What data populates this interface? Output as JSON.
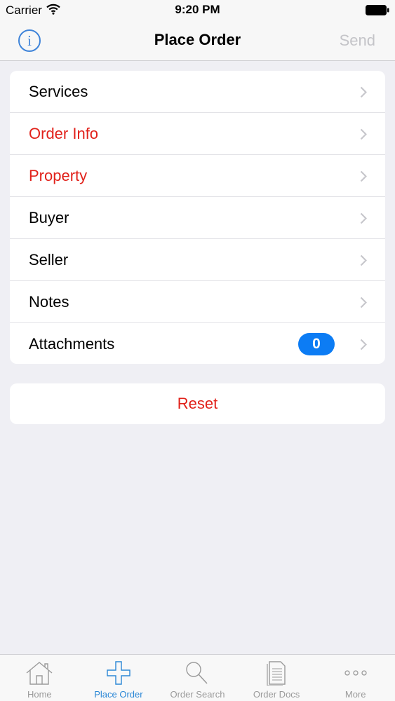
{
  "status_bar": {
    "carrier": "Carrier",
    "time": "9:20 PM"
  },
  "nav": {
    "title": "Place Order",
    "info_glyph": "i",
    "send_label": "Send",
    "send_enabled": false
  },
  "menu": {
    "items": [
      {
        "label": "Services",
        "alert": false
      },
      {
        "label": "Order Info",
        "alert": true
      },
      {
        "label": "Property",
        "alert": true
      },
      {
        "label": "Buyer",
        "alert": false
      },
      {
        "label": "Seller",
        "alert": false
      },
      {
        "label": "Notes",
        "alert": false
      },
      {
        "label": "Attachments",
        "alert": false,
        "badge": "0"
      }
    ]
  },
  "reset_label": "Reset",
  "tabs": [
    {
      "label": "Home",
      "icon": "house-icon",
      "active": false
    },
    {
      "label": "Place Order",
      "icon": "plus-icon",
      "active": true
    },
    {
      "label": "Order Search",
      "icon": "magnifier-icon",
      "active": false
    },
    {
      "label": "Order Docs",
      "icon": "document-icon",
      "active": false
    },
    {
      "label": "More",
      "icon": "more-dots-icon",
      "active": false
    }
  ],
  "colors": {
    "accent": "#2a87d6",
    "alert": "#e1221b",
    "badge": "#0c7cf4",
    "disabled": "#c4c4c8"
  }
}
